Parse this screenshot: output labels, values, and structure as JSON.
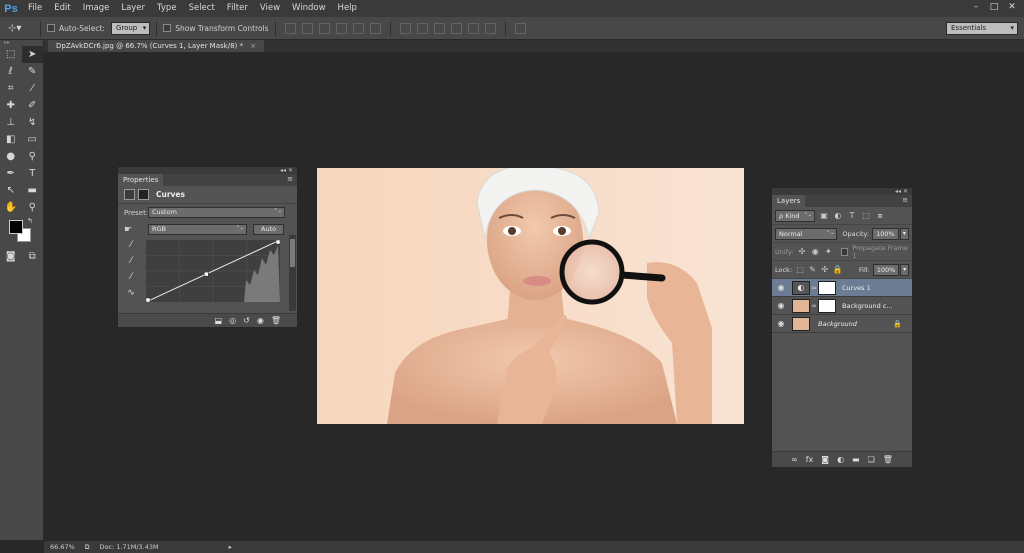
{
  "menubar": {
    "logo": "Ps",
    "items": [
      "File",
      "Edit",
      "Image",
      "Layer",
      "Type",
      "Select",
      "Filter",
      "View",
      "Window",
      "Help"
    ],
    "controls": [
      "–",
      "□",
      "✕"
    ]
  },
  "options": {
    "auto_select_label": "Auto-Select:",
    "auto_select_target": "Group",
    "show_transform_label": "Show Transform Controls",
    "workspace": "Essentials"
  },
  "document": {
    "tab_title": "DpZAvkDCr6.jpg @ 66.7% (Curves 1, Layer Mask/8) *",
    "close": "×"
  },
  "status": {
    "zoom": "66.67%",
    "doc": "Doc: 1.71M/3.43M",
    "arrow": "▸"
  },
  "properties": {
    "tab": "Properties",
    "title": "Curves",
    "preset_label": "Preset:",
    "preset_value": "Custom",
    "channel": "RGB",
    "auto_label": "Auto",
    "curve_points": [
      [
        0,
        0
      ],
      [
        0.45,
        0.45
      ],
      [
        1,
        1
      ]
    ]
  },
  "layers": {
    "tab": "Layers",
    "kind_label": "ρ Kind",
    "blend_mode": "Normal",
    "opacity_label": "Opacity:",
    "opacity_value": "100%",
    "unify_label": "Unify:",
    "propagate_label": "Propagate Frame 1",
    "lock_label": "Lock:",
    "fill_label": "Fill:",
    "fill_value": "100%",
    "items": [
      {
        "name": "Curves 1",
        "selected": true
      },
      {
        "name": "Background c...",
        "selected": false
      },
      {
        "name": "Background",
        "selected": false
      }
    ]
  },
  "colors": {
    "accent": "#4fa3e8",
    "selection": "#6b7c93",
    "foreground": "#000000",
    "background": "#ffffff"
  }
}
